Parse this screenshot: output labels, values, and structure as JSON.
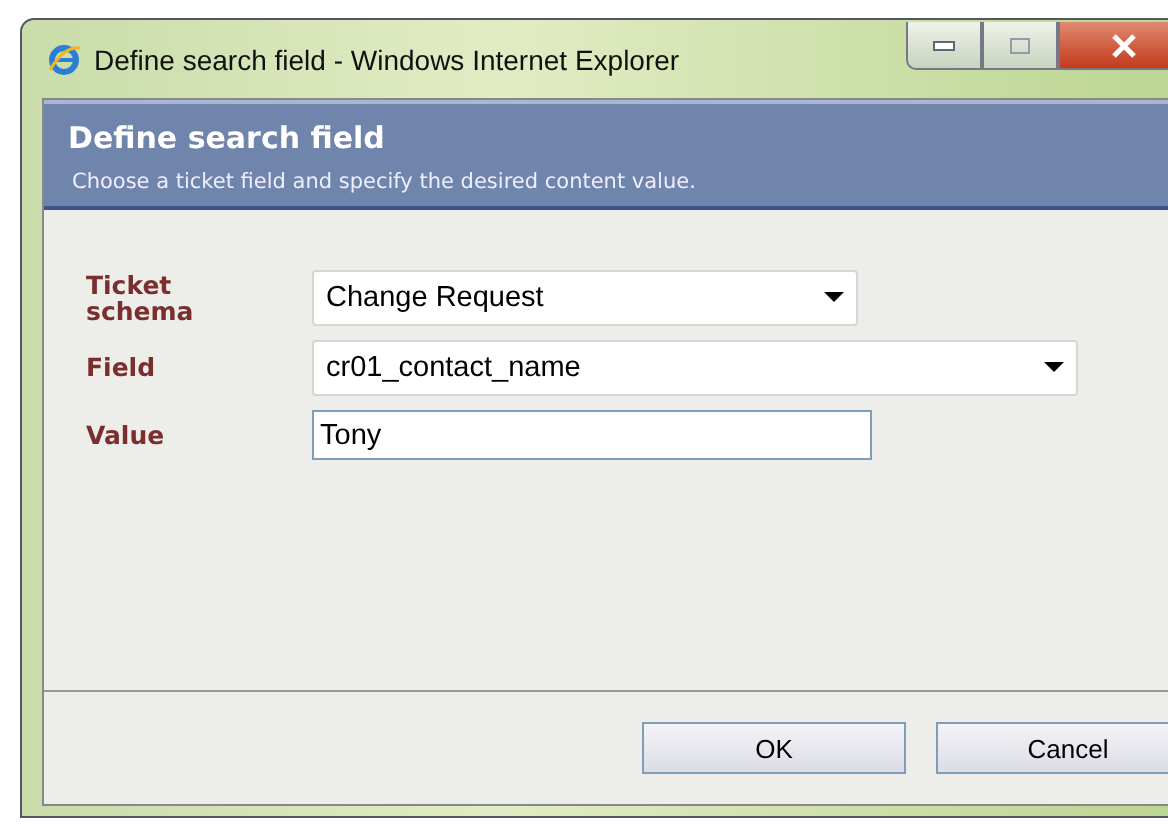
{
  "window": {
    "title": "Define search field - Windows Internet Explorer"
  },
  "header": {
    "title": "Define search field",
    "subtitle": "Choose a ticket field and specify the desired content value."
  },
  "fields": [
    {
      "label": "Ticket schema",
      "kind": "select",
      "value": "Change Request"
    },
    {
      "label": "Field",
      "kind": "select",
      "value": "cr01_contact_name"
    },
    {
      "label": "Value",
      "kind": "text",
      "value": "Tony"
    }
  ],
  "buttons": [
    "OK",
    "Cancel"
  ]
}
